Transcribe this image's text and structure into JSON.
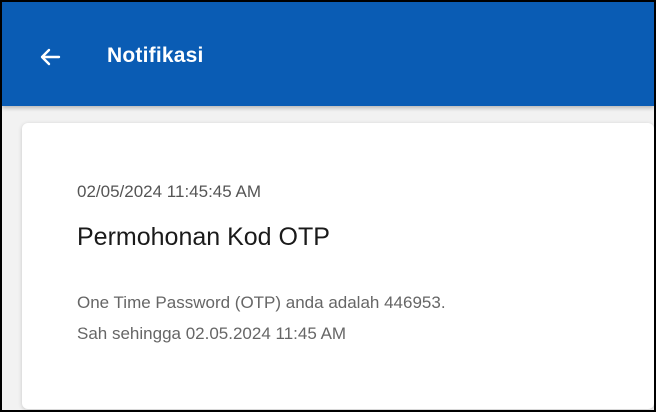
{
  "app_bar": {
    "title": "Notifikasi",
    "back_icon": "arrow-left-icon",
    "background_color": "#0a5cb4"
  },
  "notification": {
    "timestamp": "02/05/2024 11:45:45 AM",
    "title": "Permohonan Kod OTP",
    "body_line1": "One Time Password (OTP) anda adalah 446953.",
    "body_line2": "Sah sehingga 02.05.2024 11:45 AM"
  }
}
